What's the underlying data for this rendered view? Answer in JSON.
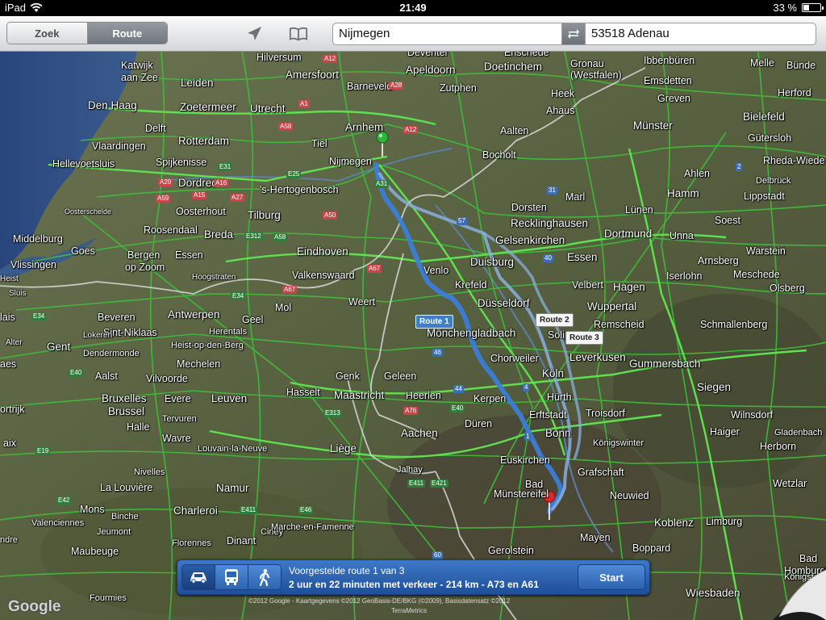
{
  "status_bar": {
    "carrier": "iPad",
    "time": "21:49",
    "battery": "33 %",
    "battery_level": 0.33
  },
  "toolbar": {
    "segments": {
      "search": "Zoek",
      "route": "Route"
    },
    "active_segment": "Route",
    "from_value": "Nijmegen",
    "to_value": "53518 Adenau",
    "icons": [
      "location-arrow-icon",
      "bookmarks-icon",
      "swap-icon"
    ]
  },
  "map": {
    "cities": {
      "katwijk": "Katwijk",
      "aan_zee": "aan Zee",
      "leiden": "Leiden",
      "den_haag": "Den Haag",
      "zoetermeer": "Zoetermeer",
      "delft": "Delft",
      "vlaardingen": "Vlaardingen",
      "rotterdam": "Rotterdam",
      "hellevoetsluis": "Hellevoetsluis",
      "spijkenisse": "Spijkenisse",
      "dordrecht": "Dordrecht",
      "oosterschelde": "Oosterschelde",
      "oosterhout": "Oosterhout",
      "middelburg": "Middelburg",
      "goes": "Goes",
      "vlissingen": "Vlissingen",
      "roosendaal": "Roosendaal",
      "breda": "Breda",
      "tilburg": "Tilburg",
      "bergen": "Bergen",
      "op_zoom": "op Zoom",
      "essen": "Essen",
      "hilversum": "Hilversum",
      "amersfoort": "Amersfoort",
      "barneveld": "Barneveld",
      "utrecht": "Utrecht",
      "apeldoorn": "Apeldoorn",
      "zutphen": "Zutphen",
      "deventer": "Deventer",
      "arnhem": "Arnhem",
      "nijmegen": "Nijmegen",
      "tiel": "Tiel",
      "hertogenbosch": "'s-Hertogenbosch",
      "eindhoven": "Eindhoven",
      "valkenswaard": "Valkenswaard",
      "hoogstraten": "Hoogstraten",
      "weert": "Weert",
      "venlo": "Venlo",
      "bocholt": "Bocholt",
      "doetinchem": "Doetinchem",
      "aalten": "Aalten",
      "enschede": "Enschede",
      "gronau": "Gronau",
      "westfalen": "(Westfalen)",
      "ibbenburen": "Ibbenbüren",
      "emsdetten": "Emsdetten",
      "greven": "Greven",
      "heek": "Heek",
      "ahaus": "Ahaus",
      "munster": "Münster",
      "melle": "Melle",
      "bunde": "Bünde",
      "herford": "Herford",
      "bielefeld": "Bielefeld",
      "gutersloh": "Gütersloh",
      "rheda": "Rheda-Wiede",
      "ahlen": "Ahlen",
      "delbruck": "Delbrück",
      "lippstadt": "Lippstadt",
      "hamm": "Hamm",
      "lunen": "Lünen",
      "soest": "Soest",
      "dortmund": "Dortmund",
      "unna": "Unna",
      "dorsten": "Dorsten",
      "marl": "Marl",
      "recklinghausen": "Recklinghausen",
      "gelsenkirchen": "Gelsenkirchen",
      "duisburg": "Duisburg",
      "essen_de": "Essen",
      "krefeld": "Krefeld",
      "velbert": "Velbert",
      "hagen": "Hagen",
      "iserlohn": "Iserlohn",
      "arnsberg": "Arnsberg",
      "warstein": "Warstein",
      "meschede": "Meschede",
      "olsberg": "Olsberg",
      "dusseldorf": "Düsseldorf",
      "wuppertal": "Wuppertal",
      "remscheid": "Remscheid",
      "schmallenberg": "Schmallenberg",
      "solingen": "Solingen",
      "leverkusen": "Leverkusen",
      "monchengladbach": "Mönchengladbach",
      "chorweiler": "Chorweiler",
      "koln": "Köln",
      "gummersbach": "Gummersbach",
      "siegen": "Siegen",
      "hurth": "Hürth",
      "kerpen": "Kerpen",
      "erftstadt": "Erftstadt",
      "troisdorf": "Troisdorf",
      "bonn": "Bonn",
      "wilnsdorf": "Wilnsdorf",
      "haiger": "Haiger",
      "herborn": "Herborn",
      "gladenbach": "Gladenbach",
      "konigswinter": "Königswinter",
      "euskirchen": "Euskirchen",
      "duren": "Düren",
      "aachen": "Aachen",
      "heerlen": "Heerlen",
      "geleen": "Geleen",
      "maastricht": "Maastricht",
      "genk": "Genk",
      "hasselt": "Hasselt",
      "liege": "Liège",
      "bad": "Bad",
      "munstereifel": "Münstereifel",
      "grafschaft": "Grafschaft",
      "neuwied": "Neuwied",
      "wetzlar": "Wetzlar",
      "koblenz": "Koblenz",
      "limburg": "Limburg",
      "mayen": "Mayen",
      "gerolstein": "Gerolstein",
      "boppard": "Boppard",
      "bad_homburg": "Bad",
      "homburg": "Homburg",
      "konigstein": "Königste",
      "wiesbaden": "Wiesbaden",
      "antwerpen": "Antwerpen",
      "beveren": "Beveren",
      "sint_niklaas": "Sint-Niklaas",
      "lokeren": "Lokeren",
      "herentals": "Herentals",
      "heist": "Heist-op-den-Berg",
      "geel": "Geel",
      "mol": "Mol",
      "mechelen": "Mechelen",
      "dendermonde": "Dendermonde",
      "gent": "Gent",
      "aalst": "Aalst",
      "vilvoorde": "Vilvoorde",
      "bruxelles": "Bruxelles",
      "brussel": "Brussel",
      "evere": "Evere",
      "leuven": "Leuven",
      "tervuren": "Tervuren",
      "halle": "Halle",
      "wavre": "Wavre",
      "louvain": "Louvain-la-Neuve",
      "nivelles": "Nivelles",
      "la_louviere": "La Louvière",
      "namur": "Namur",
      "mons": "Mons",
      "binche": "Binche",
      "charleroi": "Charleroi",
      "valenciennes": "Valenciennes",
      "jeumont": "Jeumont",
      "maubeuge": "Maubeuge",
      "fourmies": "Fourmies",
      "florennes": "Florennes",
      "dinant": "Dinant",
      "ciney": "Ciney",
      "marche": "Marche-en-Famenne",
      "jalhay": "Jalhay",
      "kortrijk": "ortrijk",
      "baix": "aix",
      "heist_be": "Heist",
      "sluis": "Sluis",
      "alter": "Alter",
      "laisne": "lais",
      "aes": "aes",
      "ndre": "ndre"
    },
    "highway_labels": [
      "A12",
      "A28",
      "A1",
      "A50",
      "A12",
      "A15",
      "A16",
      "A29",
      "A59",
      "A27",
      "A58",
      "E312",
      "A58",
      "E34",
      "A67",
      "E34",
      "A67",
      "E25",
      "E31",
      "E313",
      "E40",
      "E42",
      "E411",
      "E46",
      "A76",
      "E40",
      "E411",
      "60",
      "57",
      "40",
      "46",
      "44",
      "1",
      "4",
      "31",
      "2",
      "A31",
      "E421",
      "E19"
    ],
    "routes": [
      {
        "label": "Route 1",
        "selected": true
      },
      {
        "label": "Route 2",
        "selected": false
      },
      {
        "label": "Route 3",
        "selected": false
      }
    ],
    "google_logo": "Google",
    "copyright": "©2012 Google - Kaartgegevens ©2012 GeoBasis-DE/BKG (©2009), Basisdatensatz ©2012",
    "copyright_line2": "TerraMetrics"
  },
  "route_bar": {
    "modes": [
      "car-icon",
      "bus-icon",
      "walk-icon"
    ],
    "active_mode": "car",
    "line1": "Voorgestelde route 1 van 3",
    "line2": "2 uur en 22 minuten met verkeer - 214 km - A73 en A61",
    "start_label": "Start"
  }
}
